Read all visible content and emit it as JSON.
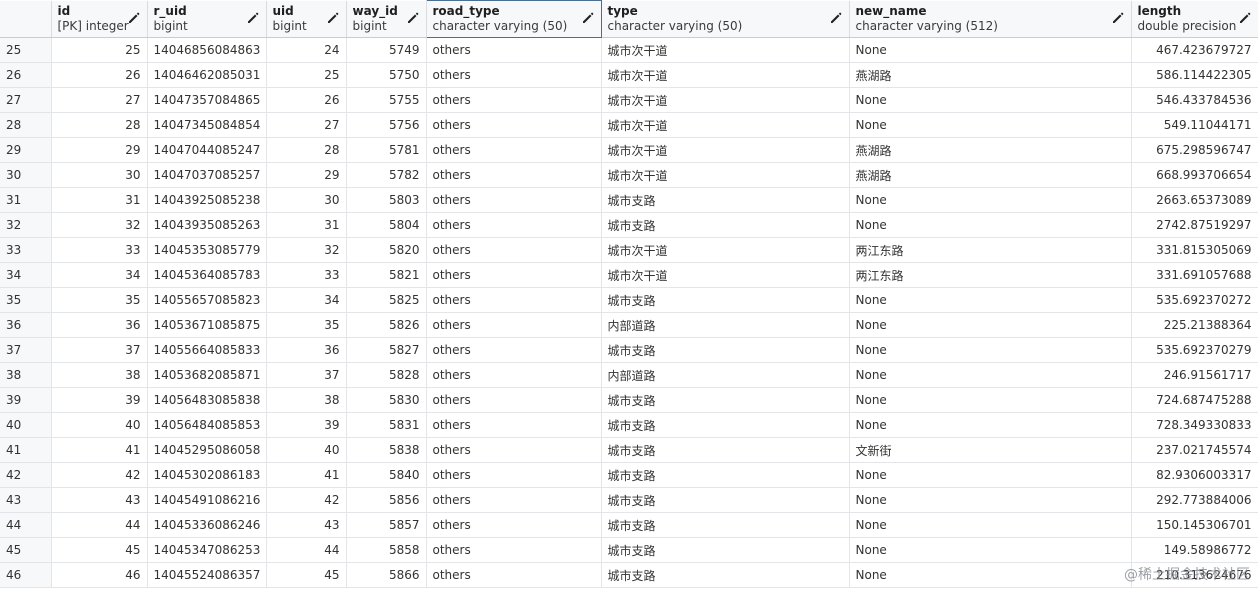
{
  "columns": [
    {
      "name": "",
      "type": ""
    },
    {
      "name": "id",
      "type": "[PK] integer"
    },
    {
      "name": "r_uid",
      "type": "bigint"
    },
    {
      "name": "uid",
      "type": "bigint"
    },
    {
      "name": "way_id",
      "type": "bigint"
    },
    {
      "name": "road_type",
      "type": "character varying (50)"
    },
    {
      "name": "type",
      "type": "character varying (50)"
    },
    {
      "name": "new_name",
      "type": "character varying (512)"
    },
    {
      "name": "length",
      "type": "double precision"
    }
  ],
  "edit_icon": "pencil-icon",
  "rows": [
    [
      "25",
      "25",
      "14046856084863",
      "24",
      "5749",
      "others",
      "城市次干道",
      "None",
      "467.423679727"
    ],
    [
      "26",
      "26",
      "14046462085031",
      "25",
      "5750",
      "others",
      "城市次干道",
      "燕湖路",
      "586.114422305"
    ],
    [
      "27",
      "27",
      "14047357084865",
      "26",
      "5755",
      "others",
      "城市次干道",
      "None",
      "546.433784536"
    ],
    [
      "28",
      "28",
      "14047345084854",
      "27",
      "5756",
      "others",
      "城市次干道",
      "None",
      "549.11044171"
    ],
    [
      "29",
      "29",
      "14047044085247",
      "28",
      "5781",
      "others",
      "城市次干道",
      "燕湖路",
      "675.298596747"
    ],
    [
      "30",
      "30",
      "14047037085257",
      "29",
      "5782",
      "others",
      "城市次干道",
      "燕湖路",
      "668.993706654"
    ],
    [
      "31",
      "31",
      "14043925085238",
      "30",
      "5803",
      "others",
      "城市支路",
      "None",
      "2663.65373089"
    ],
    [
      "32",
      "32",
      "14043935085263",
      "31",
      "5804",
      "others",
      "城市支路",
      "None",
      "2742.87519297"
    ],
    [
      "33",
      "33",
      "14045353085779",
      "32",
      "5820",
      "others",
      "城市次干道",
      "两江东路",
      "331.815305069"
    ],
    [
      "34",
      "34",
      "14045364085783",
      "33",
      "5821",
      "others",
      "城市次干道",
      "两江东路",
      "331.691057688"
    ],
    [
      "35",
      "35",
      "14055657085823",
      "34",
      "5825",
      "others",
      "城市支路",
      "None",
      "535.692370272"
    ],
    [
      "36",
      "36",
      "14053671085875",
      "35",
      "5826",
      "others",
      "内部道路",
      "None",
      "225.21388364"
    ],
    [
      "37",
      "37",
      "14055664085833",
      "36",
      "5827",
      "others",
      "城市支路",
      "None",
      "535.692370279"
    ],
    [
      "38",
      "38",
      "14053682085871",
      "37",
      "5828",
      "others",
      "内部道路",
      "None",
      "246.91561717"
    ],
    [
      "39",
      "39",
      "14056483085838",
      "38",
      "5830",
      "others",
      "城市支路",
      "None",
      "724.687475288"
    ],
    [
      "40",
      "40",
      "14056484085853",
      "39",
      "5831",
      "others",
      "城市支路",
      "None",
      "728.349330833"
    ],
    [
      "41",
      "41",
      "14045295086058",
      "40",
      "5838",
      "others",
      "城市支路",
      "文新街",
      "237.021745574"
    ],
    [
      "42",
      "42",
      "14045302086183",
      "41",
      "5840",
      "others",
      "城市支路",
      "None",
      "82.9306003317"
    ],
    [
      "43",
      "43",
      "14045491086216",
      "42",
      "5856",
      "others",
      "城市支路",
      "None",
      "292.773884006"
    ],
    [
      "44",
      "44",
      "14045336086246",
      "43",
      "5857",
      "others",
      "城市支路",
      "None",
      "150.145306701"
    ],
    [
      "45",
      "45",
      "14045347086253",
      "44",
      "5858",
      "others",
      "城市支路",
      "None",
      "149.58986772"
    ],
    [
      "46",
      "46",
      "14045524086357",
      "45",
      "5866",
      "others",
      "城市支路",
      "None",
      "210.313624676"
    ]
  ],
  "watermark": "@稀土掘金技术社区"
}
